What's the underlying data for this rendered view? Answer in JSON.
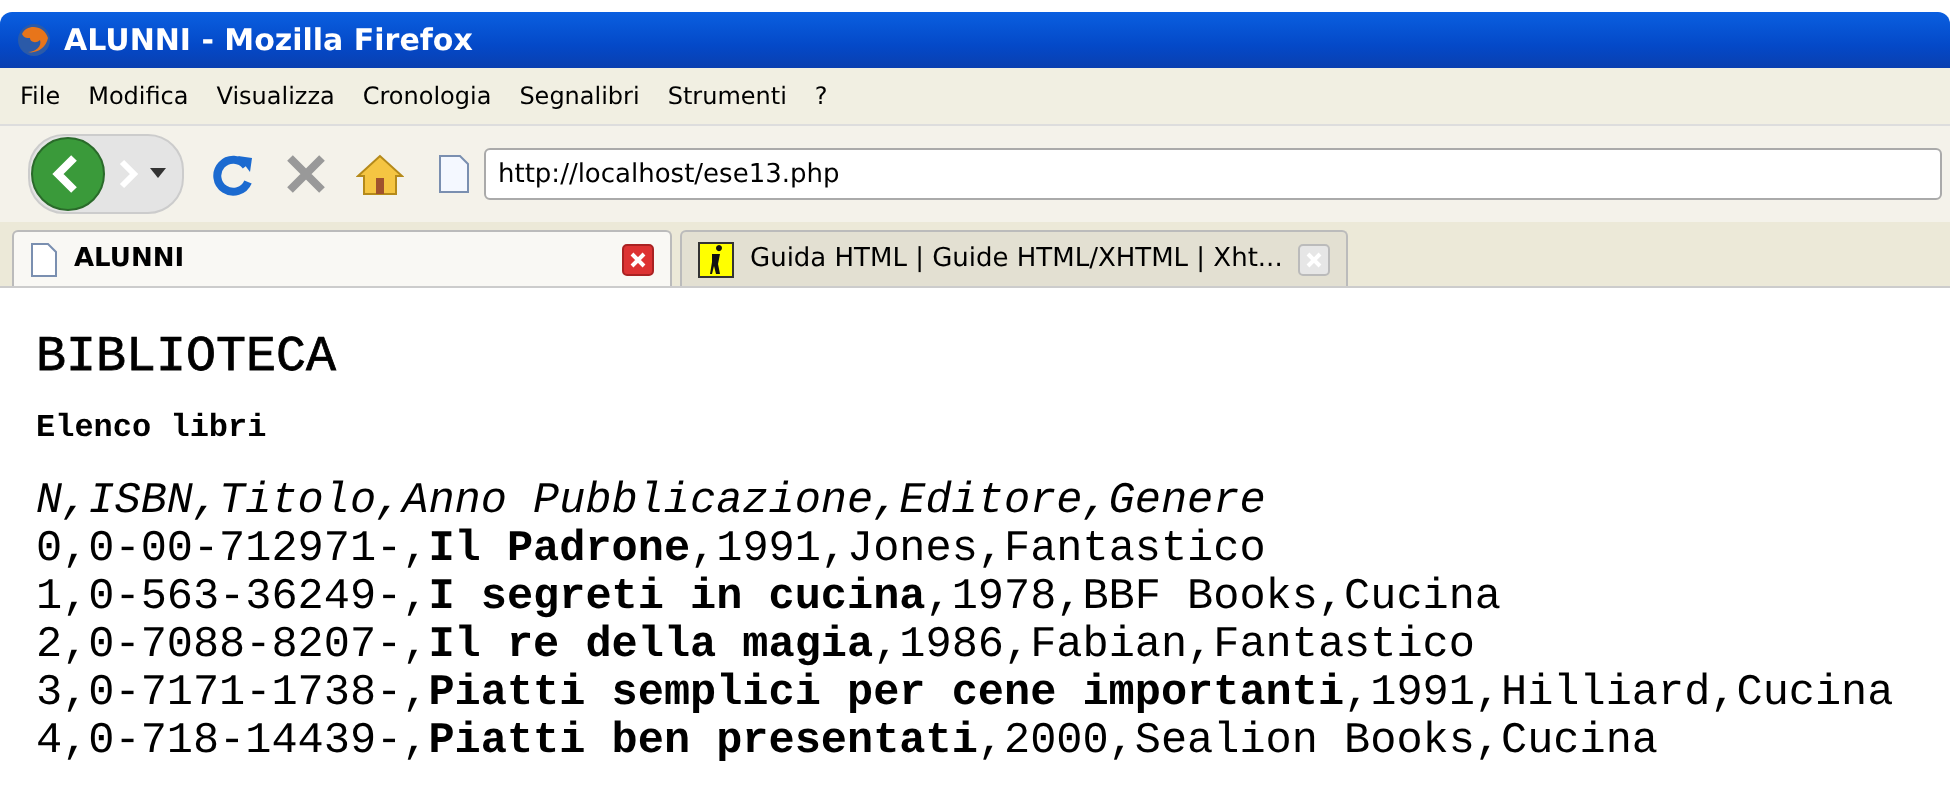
{
  "window": {
    "title": "ALUNNI - Mozilla Firefox"
  },
  "menu": [
    "File",
    "Modifica",
    "Visualizza",
    "Cronologia",
    "Segnalibri",
    "Strumenti",
    "?"
  ],
  "address": {
    "value": "http://localhost/ese13.php"
  },
  "tabs": [
    {
      "label": "ALUNNI",
      "selected": true
    },
    {
      "label": "Guida HTML | Guide HTML/XHTML | Xht...",
      "selected": false
    }
  ],
  "page": {
    "heading": "BIBLIOTECA",
    "subheading": "Elenco libri",
    "lines": [
      {
        "kind": "header",
        "text": "N,ISBN,Titolo,Anno Pubblicazione,Editore,Genere"
      },
      {
        "kind": "row",
        "text": "0,0-00-712971-,**Il Padrone**,1991,Jones,Fantastico"
      },
      {
        "kind": "row",
        "text": "1,0-563-36249-,**I segreti in cucina**,1978,BBF Books,Cucina"
      },
      {
        "kind": "row",
        "text": "2,0-7088-8207-,**Il re della magia**,1986,Fabian,Fantastico"
      },
      {
        "kind": "row",
        "text": "3,0-7171-1738-,**Piatti semplici per cene importanti**,1991,Hilliard,Cucina"
      },
      {
        "kind": "row",
        "text": "4,0-718-14439-,**Piatti ben presentati**,2000,Sealion Books,Cucina"
      }
    ]
  }
}
